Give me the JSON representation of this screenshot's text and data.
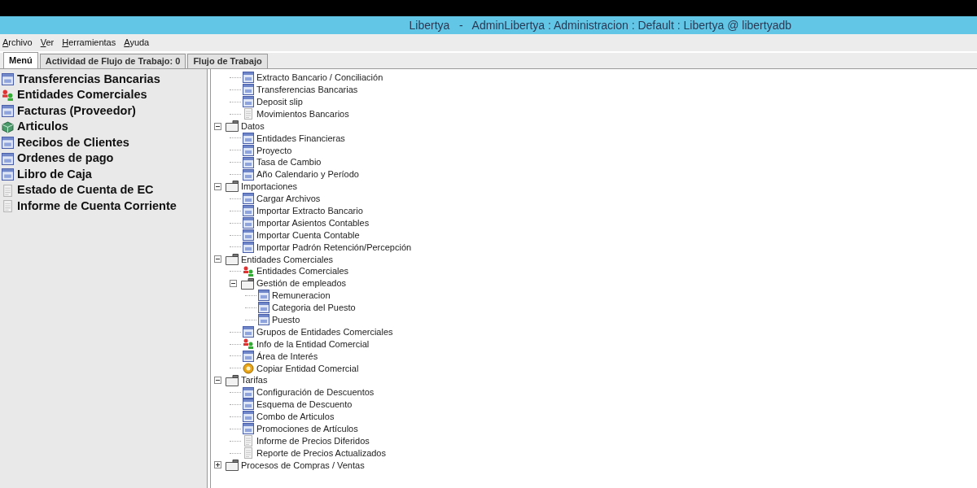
{
  "window": {
    "title": "Libertya   -   AdminLibertya : Administracion : Default : Libertya @ libertyadb"
  },
  "menu_bar": [
    "Archivo",
    "Ver",
    "Herramientas",
    "Ayuda"
  ],
  "tabs": [
    {
      "label": "Menú",
      "selected": true
    },
    {
      "label": "Actividad de Flujo de Trabajo: 0",
      "selected": false
    },
    {
      "label": "Flujo de Trabajo",
      "selected": false
    }
  ],
  "favorites": [
    {
      "label": "Transferencias Bancarias",
      "kind": "window"
    },
    {
      "label": "Entidades Comerciales",
      "kind": "partner"
    },
    {
      "label": "Facturas (Proveedor)",
      "kind": "window"
    },
    {
      "label": "Articulos",
      "kind": "product"
    },
    {
      "label": "Recibos de Clientes",
      "kind": "window"
    },
    {
      "label": "Ordenes de pago",
      "kind": "window"
    },
    {
      "label": "Libro de Caja",
      "kind": "window"
    },
    {
      "label": "Estado de Cuenta de EC",
      "kind": "report"
    },
    {
      "label": "Informe de Cuenta Corriente",
      "kind": "report"
    }
  ],
  "tree": [
    {
      "kind": "continued",
      "children": [
        {
          "label": "Extracto Bancario / Conciliación",
          "kind": "window"
        },
        {
          "label": "Transferencias Bancarias",
          "kind": "window"
        },
        {
          "label": "Deposit slip",
          "kind": "window"
        },
        {
          "label": "Movimientos Bancarios",
          "kind": "report"
        }
      ]
    },
    {
      "label": "Datos",
      "kind": "folder",
      "expanded": true,
      "children": [
        {
          "label": "Entidades Financieras",
          "kind": "window"
        },
        {
          "label": "Proyecto",
          "kind": "window"
        },
        {
          "label": "Tasa de Cambio",
          "kind": "window"
        },
        {
          "label": "Año Calendario y Período",
          "kind": "window"
        }
      ]
    },
    {
      "label": "Importaciones",
      "kind": "folder",
      "expanded": true,
      "children": [
        {
          "label": "Cargar Archivos",
          "kind": "window"
        },
        {
          "label": "Importar Extracto Bancario",
          "kind": "window"
        },
        {
          "label": "Importar Asientos Contables",
          "kind": "window"
        },
        {
          "label": "Importar Cuenta Contable",
          "kind": "window"
        },
        {
          "label": "Importar Padrón Retención/Percepción",
          "kind": "window"
        }
      ]
    },
    {
      "label": "Entidades Comerciales",
      "kind": "folder",
      "expanded": true,
      "children": [
        {
          "label": "Entidades Comerciales",
          "kind": "partner"
        },
        {
          "label": "Gestión de empleados",
          "kind": "folder",
          "expanded": true,
          "children": [
            {
              "label": "Remuneracion",
              "kind": "window"
            },
            {
              "label": "Categoria del Puesto",
              "kind": "window"
            },
            {
              "label": "Puesto",
              "kind": "window"
            }
          ]
        },
        {
          "label": "Grupos de Entidades Comerciales",
          "kind": "window"
        },
        {
          "label": "Info de la Entidad Comercial",
          "kind": "partner"
        },
        {
          "label": "Área de Interés",
          "kind": "window"
        },
        {
          "label": "Copiar Entidad Comercial",
          "kind": "process"
        }
      ]
    },
    {
      "label": "Tarifas",
      "kind": "folder",
      "expanded": true,
      "children": [
        {
          "label": "Configuración de Descuentos",
          "kind": "window"
        },
        {
          "label": "Esquema de Descuento",
          "kind": "window"
        },
        {
          "label": "Combo de Articulos",
          "kind": "window"
        },
        {
          "label": "Promociones de Artículos",
          "kind": "window"
        },
        {
          "label": "Informe de Precios Diferidos",
          "kind": "report"
        },
        {
          "label": "Reporte de Precios Actualizados",
          "kind": "report"
        }
      ]
    },
    {
      "label": "Procesos de Compras / Ventas",
      "kind": "folder",
      "expanded": false
    }
  ]
}
